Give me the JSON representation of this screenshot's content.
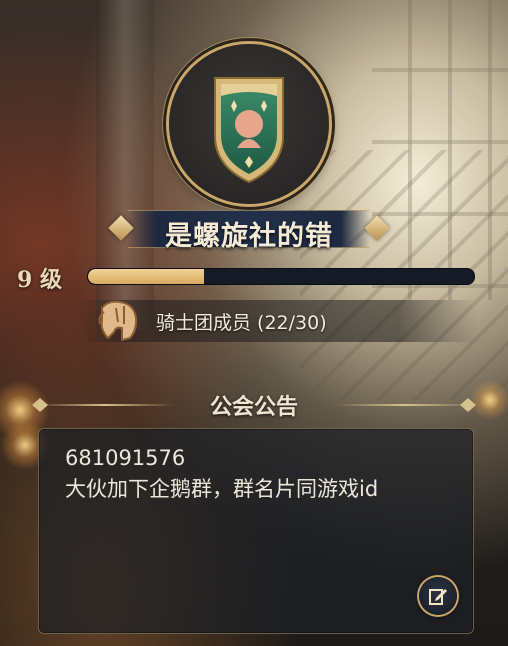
{
  "guild": {
    "name": "是螺旋社的错",
    "level_label": "9 级",
    "level_progress": 0.3,
    "members_label": "骑士团成员 (22/30)"
  },
  "notice": {
    "title": "公会公告",
    "text": "681091576\n大伙加下企鹅群，群名片同游戏id"
  },
  "icons": {
    "emblem": "guild-crest-icon",
    "members": "knight-helmet-icon",
    "edit": "edit-icon"
  },
  "colors": {
    "accent_gold": "#c9a86a",
    "progress_fill": "#e4b978",
    "banner_navy": "#223049",
    "crest_green": "#2f7a5c"
  }
}
